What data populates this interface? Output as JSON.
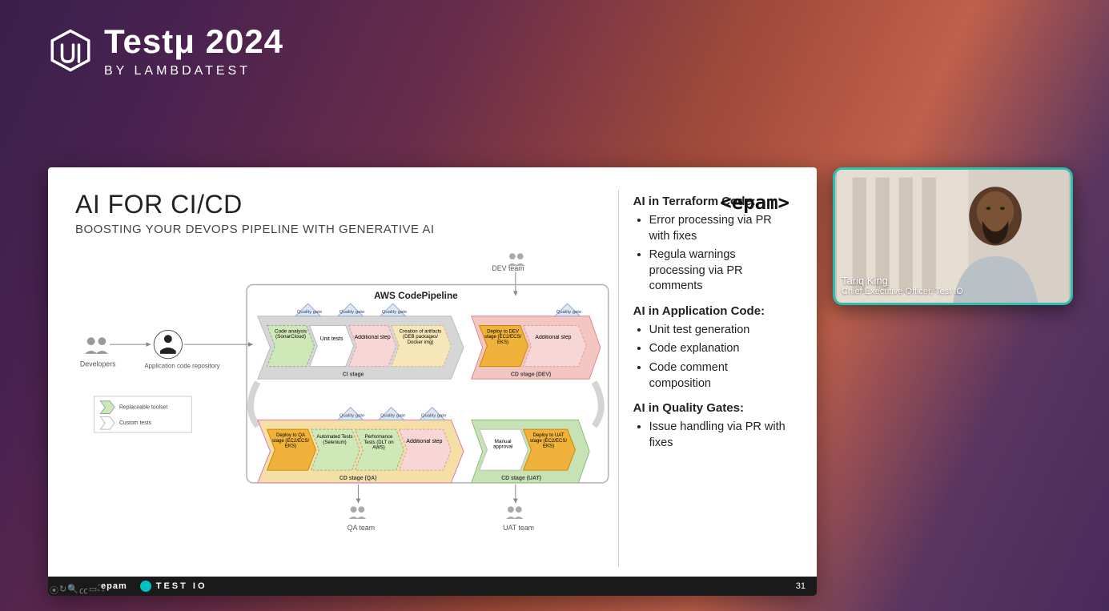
{
  "event": {
    "title": "Testμ 2024",
    "byline": "BY LAMBDATEST"
  },
  "slide": {
    "title": "AI FOR CI/CD",
    "subtitle": "BOOSTING YOUR DEVOPS PIPELINE WITH GENERATIVE AI",
    "company_logo_text": "<epam>",
    "page_number": "31",
    "footer_brand1": "epam",
    "footer_brand2": "TEST IO",
    "diagram": {
      "pipeline_title": "AWS CodePipeline",
      "dev_team": "DEV team",
      "developers": "Developers",
      "repo": "Application code repository",
      "qa_team": "QA team",
      "uat_team": "UAT team",
      "qgate": "Quality gate",
      "legend_replace": "Replaceable toolset",
      "legend_custom": "Custom tests",
      "ci_stage": "CI stage",
      "cd_dev": "CD stage (DEV)",
      "cd_qa": "CD stage (QA)",
      "cd_uat": "CD stage (UAT)",
      "box_code_analysis": "Code analysis (SonarCloud)",
      "box_unit_tests": "Unit tests",
      "box_additional": "Additional step",
      "box_artifacts": "Creation of artifacts (DEB packages/ Docker img)",
      "box_deploy_dev": "Deploy to DEV stage (EC2/ECS/ EKS)",
      "box_deploy_qa": "Deploy to QA stage (EC2/ECS/ EKS)",
      "box_auto_tests": "Automated Tests (Selenium)",
      "box_perf": "Performance Tests (DLT on AWS)",
      "box_manual": "Manual approval",
      "box_deploy_uat": "Deploy to UAT stage (EC2/ECS/ EKS)"
    },
    "sections": [
      {
        "heading": "AI in Terraform Code:",
        "items": [
          "Error processing via PR with fixes",
          "Regula warnings processing via PR comments"
        ]
      },
      {
        "heading": "AI in Application Code:",
        "items": [
          "Unit test generation",
          "Code explanation",
          "Code comment composition"
        ]
      },
      {
        "heading": "AI in Quality Gates:",
        "items": [
          "Issue handling via PR with fixes"
        ]
      }
    ]
  },
  "speaker": {
    "name": "Tariq King",
    "role": "Chief Executive Officer, Test IO"
  }
}
